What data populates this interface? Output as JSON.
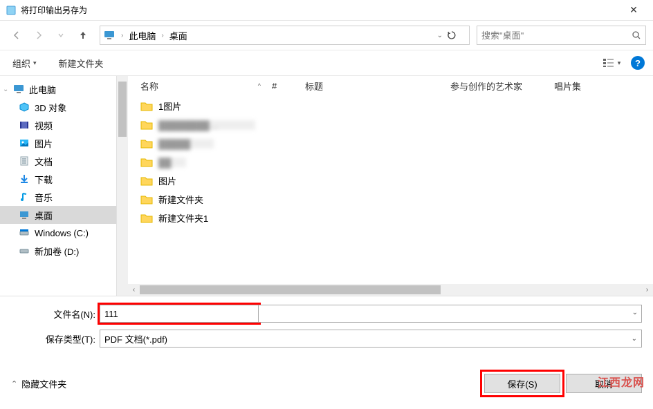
{
  "window": {
    "title": "将打印输出另存为"
  },
  "breadcrumb": {
    "root": "此电脑",
    "current": "桌面"
  },
  "search": {
    "placeholder": "搜索\"桌面\""
  },
  "toolbar": {
    "organize": "组织",
    "new_folder": "新建文件夹"
  },
  "columns": {
    "name": "名称",
    "num": "#",
    "title": "标题",
    "artist": "参与创作的艺术家",
    "album": "唱片集"
  },
  "tree": {
    "root": "此电脑",
    "items": [
      {
        "label": "3D 对象"
      },
      {
        "label": "视频"
      },
      {
        "label": "图片"
      },
      {
        "label": "文档"
      },
      {
        "label": "下载"
      },
      {
        "label": "音乐"
      },
      {
        "label": "桌面"
      },
      {
        "label": "Windows (C:)"
      },
      {
        "label": "新加卷 (D:)"
      }
    ]
  },
  "files": [
    {
      "name": "1图片"
    },
    {
      "name": "…",
      "blurred": true
    },
    {
      "name": "",
      "blurred": true
    },
    {
      "name": "",
      "blurred": true
    },
    {
      "name": "图片"
    },
    {
      "name": "新建文件夹"
    },
    {
      "name": "新建文件夹1"
    }
  ],
  "form": {
    "filename_label": "文件名(N):",
    "filename_value": "111",
    "filetype_label": "保存类型(T):",
    "filetype_value": "PDF 文档(*.pdf)"
  },
  "footer": {
    "hide_folders": "隐藏文件夹",
    "save": "保存(S)",
    "cancel": "取消"
  },
  "watermark": "江西龙网"
}
